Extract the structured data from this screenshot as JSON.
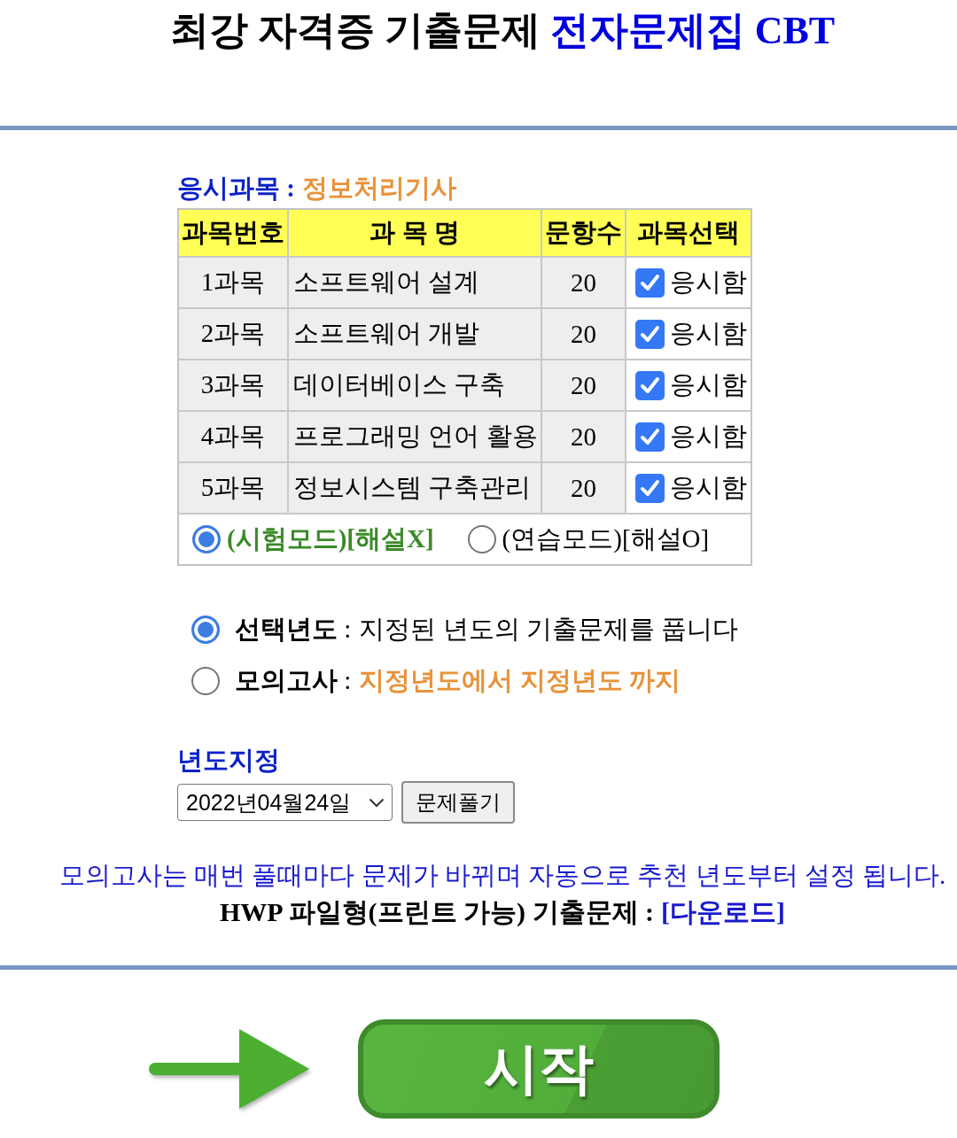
{
  "title": {
    "main": "최강 자격증 기출문제",
    "highlight": "전자문제집 CBT"
  },
  "subject": {
    "label": "응시과목 :",
    "value": "정보처리기사"
  },
  "table": {
    "columns": [
      "과목번호",
      "과 목 명",
      "문항수",
      "과목선택"
    ],
    "rows": [
      {
        "number": "1과목",
        "name": "소프트웨어 설계",
        "count": "20",
        "checked": true,
        "option": "응시함"
      },
      {
        "number": "2과목",
        "name": "소프트웨어 개발",
        "count": "20",
        "checked": true,
        "option": "응시함"
      },
      {
        "number": "3과목",
        "name": "데이터베이스 구축",
        "count": "20",
        "checked": true,
        "option": "응시함"
      },
      {
        "number": "4과목",
        "name": "프로그래밍 언어 활용",
        "count": "20",
        "checked": true,
        "option": "응시함"
      },
      {
        "number": "5과목",
        "name": "정보시스템 구축관리",
        "count": "20",
        "checked": true,
        "option": "응시함"
      }
    ],
    "modes": [
      {
        "label": "(시험모드)[해설X]",
        "selected": true
      },
      {
        "label": "(연습모드)[해설O]",
        "selected": false
      }
    ]
  },
  "range_options": [
    {
      "label": "**선택년도** :",
      "description": "지정된 년도의 기출문제를 풉니다",
      "kind": "plain",
      "selected": true
    },
    {
      "label": "**모의고사** :",
      "description": "지정년도에서 지정년도 까지",
      "kind": "highlight",
      "selected": false
    }
  ],
  "year": {
    "label": "년도지정",
    "value": "2022년04월24일",
    "button": "문제풀기"
  },
  "notice": "모의고사는 매번 풀때마다 문제가 바뀌며 자동으로 추천 년도부터 설정 됩니다.",
  "download": {
    "text": "HWP 파일형(프린트 가능) 기출문제 :",
    "link": "[다운로드]"
  },
  "start": {
    "button": "시작"
  }
}
